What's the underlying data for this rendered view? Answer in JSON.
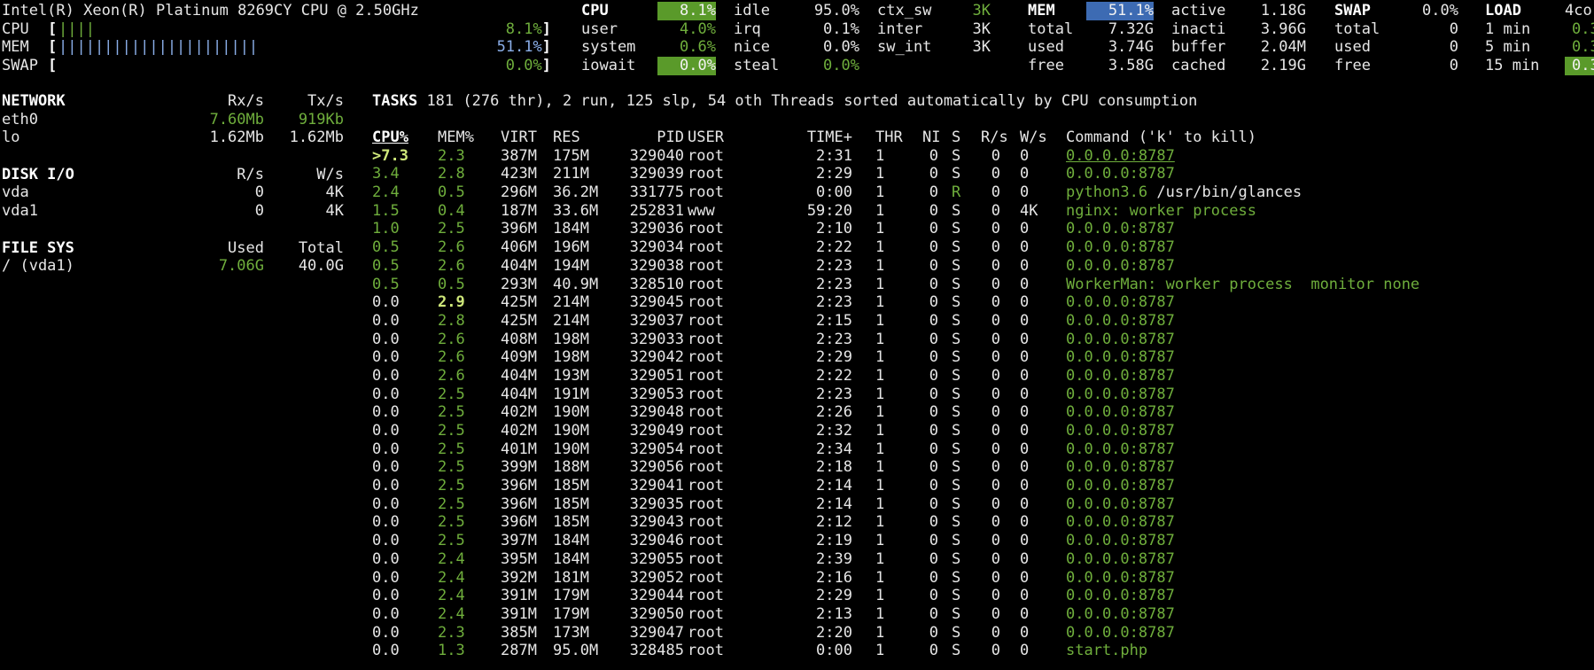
{
  "header": {
    "cpu_name": "Intel(R) Xeon(R) Platinum 8269CY CPU @ 2.50GHz"
  },
  "quicklook": [
    {
      "label": "CPU",
      "bar": "||||",
      "pct": "8.1%",
      "pct_class": "green"
    },
    {
      "label": "MEM",
      "bar": "||||||||||||||||||||||",
      "pct": "51.1%",
      "pct_class": "blue"
    },
    {
      "label": "SWAP",
      "bar": "",
      "pct": "0.0%",
      "pct_class": "green"
    }
  ],
  "cpu": {
    "title": "CPU",
    "total": "8.1%",
    "rows": [
      {
        "label": "user",
        "value": "4.0%"
      },
      {
        "label": "system",
        "value": "0.6%"
      },
      {
        "label": "iowait",
        "value": "0.0%"
      }
    ],
    "col2": [
      {
        "label": "idle",
        "value": "95.0%"
      },
      {
        "label": "irq",
        "value": "0.1%"
      },
      {
        "label": "nice",
        "value": "0.0%"
      },
      {
        "label": "steal",
        "value": "0.0%"
      }
    ],
    "col3": [
      {
        "label": "ctx_sw",
        "value": "3K"
      },
      {
        "label": "inter",
        "value": "3K"
      },
      {
        "label": "sw_int",
        "value": "3K"
      }
    ]
  },
  "mem": {
    "title": "MEM",
    "total_pct": "51.1%",
    "col1": [
      {
        "label": "total",
        "value": "7.32G"
      },
      {
        "label": "used",
        "value": "3.74G"
      },
      {
        "label": "free",
        "value": "3.58G"
      }
    ],
    "col2": [
      {
        "label": "active",
        "value": "1.18G"
      },
      {
        "label": "inacti",
        "value": "3.96G"
      },
      {
        "label": "buffer",
        "value": "2.04M"
      },
      {
        "label": "cached",
        "value": "2.19G"
      }
    ]
  },
  "swap": {
    "title": "SWAP",
    "pct": "0.0%",
    "rows": [
      {
        "label": "total",
        "value": "0"
      },
      {
        "label": "used",
        "value": "0"
      },
      {
        "label": "free",
        "value": "0"
      }
    ]
  },
  "load": {
    "title": "LOAD",
    "cores": "4co",
    "rows": [
      {
        "label": "1 min",
        "value": "0.3"
      },
      {
        "label": "5 min",
        "value": "0.3"
      },
      {
        "label": "15 min",
        "value": "0.3"
      }
    ]
  },
  "network": {
    "title": "NETWORK",
    "rx_header": "Rx/s",
    "tx_header": "Tx/s",
    "rows": [
      {
        "name": "eth0",
        "rx": "7.60Mb",
        "tx": "919Kb"
      },
      {
        "name": "lo",
        "rx": "1.62Mb",
        "tx": "1.62Mb"
      }
    ]
  },
  "disk": {
    "title": "DISK I/O",
    "r_header": "R/s",
    "w_header": "W/s",
    "rows": [
      {
        "name": "vda",
        "r": "0",
        "w": "4K"
      },
      {
        "name": "vda1",
        "r": "0",
        "w": "4K"
      }
    ]
  },
  "fs": {
    "title": "FILE SYS",
    "used_header": "Used",
    "total_header": "Total",
    "rows": [
      {
        "name": "/ (vda1)",
        "used": "7.06G",
        "total": "40.0G"
      }
    ]
  },
  "tasks": {
    "label": "TASKS",
    "summary": "181 (276 thr), 2 run, 125 slp, 54 oth Threads sorted automatically by CPU consumption"
  },
  "processes": {
    "headers": {
      "cpu": "CPU%",
      "mem": "MEM%",
      "virt": "VIRT",
      "res": "RES",
      "pid": "PID",
      "user": "USER",
      "time": "TIME+",
      "thr": "THR",
      "ni": "NI",
      "s": "S",
      "rs": "R/s",
      "ws": "W/s",
      "cmd": "Command ('k' to kill)"
    },
    "rows": [
      {
        "cpu": ">7.3",
        "mem": "2.3",
        "virt": "387M",
        "res": "175M",
        "pid": "329040",
        "user": "root",
        "time": "2:31",
        "thr": "1",
        "ni": "0",
        "s": "S",
        "rs": "0",
        "ws": "0",
        "cmd": "0.0.0.0:8787",
        "cmd2": ""
      },
      {
        "cpu": "3.4",
        "mem": "2.8",
        "virt": "423M",
        "res": "211M",
        "pid": "329039",
        "user": "root",
        "time": "2:29",
        "thr": "1",
        "ni": "0",
        "s": "S",
        "rs": "0",
        "ws": "0",
        "cmd": "0.0.0.0:8787",
        "cmd2": ""
      },
      {
        "cpu": "2.4",
        "mem": "0.5",
        "virt": "296M",
        "res": "36.2M",
        "pid": "331775",
        "user": "root",
        "time": "0:00",
        "thr": "1",
        "ni": "0",
        "s": "R",
        "rs": "0",
        "ws": "0",
        "cmd": "python3.6",
        "cmd2": " /usr/bin/glances"
      },
      {
        "cpu": "1.5",
        "mem": "0.4",
        "virt": "187M",
        "res": "33.6M",
        "pid": "252831",
        "user": "www",
        "time": "59:20",
        "thr": "1",
        "ni": "0",
        "s": "S",
        "rs": "0",
        "ws": "4K",
        "cmd": "nginx: worker process",
        "cmd2": ""
      },
      {
        "cpu": "1.0",
        "mem": "2.5",
        "virt": "396M",
        "res": "184M",
        "pid": "329036",
        "user": "root",
        "time": "2:10",
        "thr": "1",
        "ni": "0",
        "s": "S",
        "rs": "0",
        "ws": "0",
        "cmd": "0.0.0.0:8787",
        "cmd2": ""
      },
      {
        "cpu": "0.5",
        "mem": "2.6",
        "virt": "406M",
        "res": "196M",
        "pid": "329034",
        "user": "root",
        "time": "2:22",
        "thr": "1",
        "ni": "0",
        "s": "S",
        "rs": "0",
        "ws": "0",
        "cmd": "0.0.0.0:8787",
        "cmd2": ""
      },
      {
        "cpu": "0.5",
        "mem": "2.6",
        "virt": "404M",
        "res": "194M",
        "pid": "329038",
        "user": "root",
        "time": "2:23",
        "thr": "1",
        "ni": "0",
        "s": "S",
        "rs": "0",
        "ws": "0",
        "cmd": "0.0.0.0:8787",
        "cmd2": ""
      },
      {
        "cpu": "0.5",
        "mem": "0.5",
        "virt": "293M",
        "res": "40.9M",
        "pid": "328510",
        "user": "root",
        "time": "2:23",
        "thr": "1",
        "ni": "0",
        "s": "S",
        "rs": "0",
        "ws": "0",
        "cmd": "WorkerMan: worker process  monitor none",
        "cmd2": ""
      },
      {
        "cpu": "0.0",
        "mem": "2.9",
        "virt": "425M",
        "res": "214M",
        "pid": "329045",
        "user": "root",
        "time": "2:23",
        "thr": "1",
        "ni": "0",
        "s": "S",
        "rs": "0",
        "ws": "0",
        "cmd": "0.0.0.0:8787",
        "cmd2": ""
      },
      {
        "cpu": "0.0",
        "mem": "2.8",
        "virt": "425M",
        "res": "214M",
        "pid": "329037",
        "user": "root",
        "time": "2:15",
        "thr": "1",
        "ni": "0",
        "s": "S",
        "rs": "0",
        "ws": "0",
        "cmd": "0.0.0.0:8787",
        "cmd2": ""
      },
      {
        "cpu": "0.0",
        "mem": "2.6",
        "virt": "408M",
        "res": "198M",
        "pid": "329033",
        "user": "root",
        "time": "2:23",
        "thr": "1",
        "ni": "0",
        "s": "S",
        "rs": "0",
        "ws": "0",
        "cmd": "0.0.0.0:8787",
        "cmd2": ""
      },
      {
        "cpu": "0.0",
        "mem": "2.6",
        "virt": "409M",
        "res": "198M",
        "pid": "329042",
        "user": "root",
        "time": "2:29",
        "thr": "1",
        "ni": "0",
        "s": "S",
        "rs": "0",
        "ws": "0",
        "cmd": "0.0.0.0:8787",
        "cmd2": ""
      },
      {
        "cpu": "0.0",
        "mem": "2.6",
        "virt": "404M",
        "res": "193M",
        "pid": "329051",
        "user": "root",
        "time": "2:22",
        "thr": "1",
        "ni": "0",
        "s": "S",
        "rs": "0",
        "ws": "0",
        "cmd": "0.0.0.0:8787",
        "cmd2": ""
      },
      {
        "cpu": "0.0",
        "mem": "2.5",
        "virt": "404M",
        "res": "191M",
        "pid": "329053",
        "user": "root",
        "time": "2:23",
        "thr": "1",
        "ni": "0",
        "s": "S",
        "rs": "0",
        "ws": "0",
        "cmd": "0.0.0.0:8787",
        "cmd2": ""
      },
      {
        "cpu": "0.0",
        "mem": "2.5",
        "virt": "402M",
        "res": "190M",
        "pid": "329048",
        "user": "root",
        "time": "2:26",
        "thr": "1",
        "ni": "0",
        "s": "S",
        "rs": "0",
        "ws": "0",
        "cmd": "0.0.0.0:8787",
        "cmd2": ""
      },
      {
        "cpu": "0.0",
        "mem": "2.5",
        "virt": "402M",
        "res": "190M",
        "pid": "329049",
        "user": "root",
        "time": "2:32",
        "thr": "1",
        "ni": "0",
        "s": "S",
        "rs": "0",
        "ws": "0",
        "cmd": "0.0.0.0:8787",
        "cmd2": ""
      },
      {
        "cpu": "0.0",
        "mem": "2.5",
        "virt": "401M",
        "res": "190M",
        "pid": "329054",
        "user": "root",
        "time": "2:34",
        "thr": "1",
        "ni": "0",
        "s": "S",
        "rs": "0",
        "ws": "0",
        "cmd": "0.0.0.0:8787",
        "cmd2": ""
      },
      {
        "cpu": "0.0",
        "mem": "2.5",
        "virt": "399M",
        "res": "188M",
        "pid": "329056",
        "user": "root",
        "time": "2:18",
        "thr": "1",
        "ni": "0",
        "s": "S",
        "rs": "0",
        "ws": "0",
        "cmd": "0.0.0.0:8787",
        "cmd2": ""
      },
      {
        "cpu": "0.0",
        "mem": "2.5",
        "virt": "396M",
        "res": "185M",
        "pid": "329041",
        "user": "root",
        "time": "2:14",
        "thr": "1",
        "ni": "0",
        "s": "S",
        "rs": "0",
        "ws": "0",
        "cmd": "0.0.0.0:8787",
        "cmd2": ""
      },
      {
        "cpu": "0.0",
        "mem": "2.5",
        "virt": "396M",
        "res": "185M",
        "pid": "329035",
        "user": "root",
        "time": "2:14",
        "thr": "1",
        "ni": "0",
        "s": "S",
        "rs": "0",
        "ws": "0",
        "cmd": "0.0.0.0:8787",
        "cmd2": ""
      },
      {
        "cpu": "0.0",
        "mem": "2.5",
        "virt": "396M",
        "res": "185M",
        "pid": "329043",
        "user": "root",
        "time": "2:12",
        "thr": "1",
        "ni": "0",
        "s": "S",
        "rs": "0",
        "ws": "0",
        "cmd": "0.0.0.0:8787",
        "cmd2": ""
      },
      {
        "cpu": "0.0",
        "mem": "2.5",
        "virt": "397M",
        "res": "184M",
        "pid": "329046",
        "user": "root",
        "time": "2:19",
        "thr": "1",
        "ni": "0",
        "s": "S",
        "rs": "0",
        "ws": "0",
        "cmd": "0.0.0.0:8787",
        "cmd2": ""
      },
      {
        "cpu": "0.0",
        "mem": "2.4",
        "virt": "395M",
        "res": "184M",
        "pid": "329055",
        "user": "root",
        "time": "2:39",
        "thr": "1",
        "ni": "0",
        "s": "S",
        "rs": "0",
        "ws": "0",
        "cmd": "0.0.0.0:8787",
        "cmd2": ""
      },
      {
        "cpu": "0.0",
        "mem": "2.4",
        "virt": "392M",
        "res": "181M",
        "pid": "329052",
        "user": "root",
        "time": "2:16",
        "thr": "1",
        "ni": "0",
        "s": "S",
        "rs": "0",
        "ws": "0",
        "cmd": "0.0.0.0:8787",
        "cmd2": ""
      },
      {
        "cpu": "0.0",
        "mem": "2.4",
        "virt": "391M",
        "res": "179M",
        "pid": "329044",
        "user": "root",
        "time": "2:29",
        "thr": "1",
        "ni": "0",
        "s": "S",
        "rs": "0",
        "ws": "0",
        "cmd": "0.0.0.0:8787",
        "cmd2": ""
      },
      {
        "cpu": "0.0",
        "mem": "2.4",
        "virt": "391M",
        "res": "179M",
        "pid": "329050",
        "user": "root",
        "time": "2:13",
        "thr": "1",
        "ni": "0",
        "s": "S",
        "rs": "0",
        "ws": "0",
        "cmd": "0.0.0.0:8787",
        "cmd2": ""
      },
      {
        "cpu": "0.0",
        "mem": "2.3",
        "virt": "385M",
        "res": "173M",
        "pid": "329047",
        "user": "root",
        "time": "2:20",
        "thr": "1",
        "ni": "0",
        "s": "S",
        "rs": "0",
        "ws": "0",
        "cmd": "0.0.0.0:8787",
        "cmd2": ""
      },
      {
        "cpu": "0.0",
        "mem": "1.3",
        "virt": "287M",
        "res": "95.0M",
        "pid": "328485",
        "user": "root",
        "time": "0:00",
        "thr": "1",
        "ni": "0",
        "s": "S",
        "rs": "0",
        "ws": "0",
        "cmd": "start.php",
        "cmd2": ""
      }
    ]
  }
}
